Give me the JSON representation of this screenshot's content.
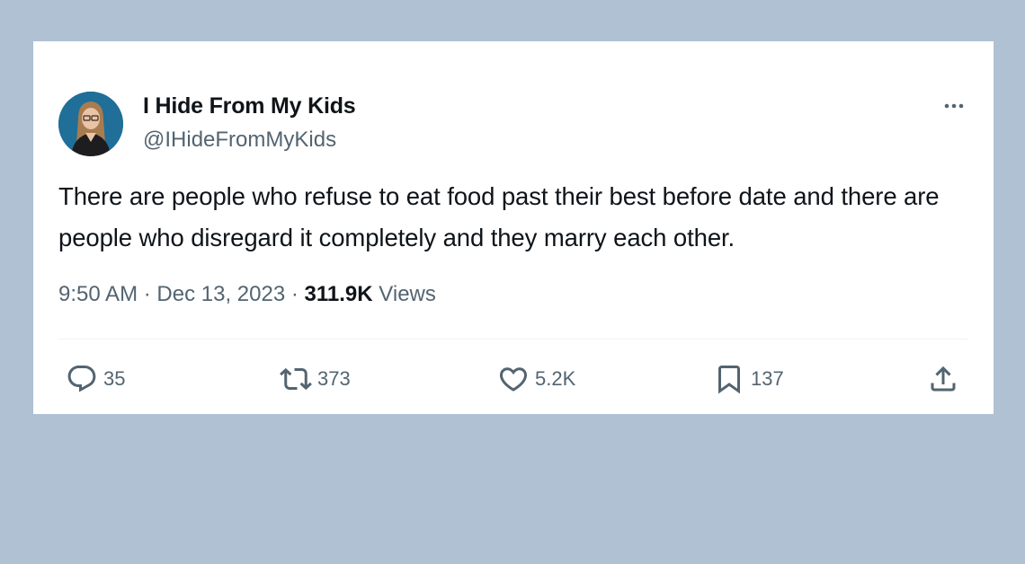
{
  "tweet": {
    "author": {
      "display_name": "I Hide From My Kids",
      "handle": "@IHideFromMyKids",
      "avatar_icon": "avatar-photo"
    },
    "text": "There are people who refuse to eat food past their best before date and there are people who disregard it completely and they marry each other.",
    "time": "9:50 AM",
    "separator": "·",
    "date": "Dec 13, 2023",
    "views_count": "311.9K",
    "views_label": "Views",
    "more_icon": "ellipsis-icon",
    "actions": {
      "reply": {
        "icon": "reply-icon",
        "count": "35"
      },
      "retweet": {
        "icon": "retweet-icon",
        "count": "373"
      },
      "like": {
        "icon": "heart-icon",
        "count": "5.2K"
      },
      "bookmark": {
        "icon": "bookmark-icon",
        "count": "137"
      },
      "share": {
        "icon": "share-icon"
      }
    }
  },
  "colors": {
    "page_background": "#afc1d3",
    "card_background": "#ffffff",
    "primary_text": "#0f1419",
    "secondary_text": "#536471"
  }
}
